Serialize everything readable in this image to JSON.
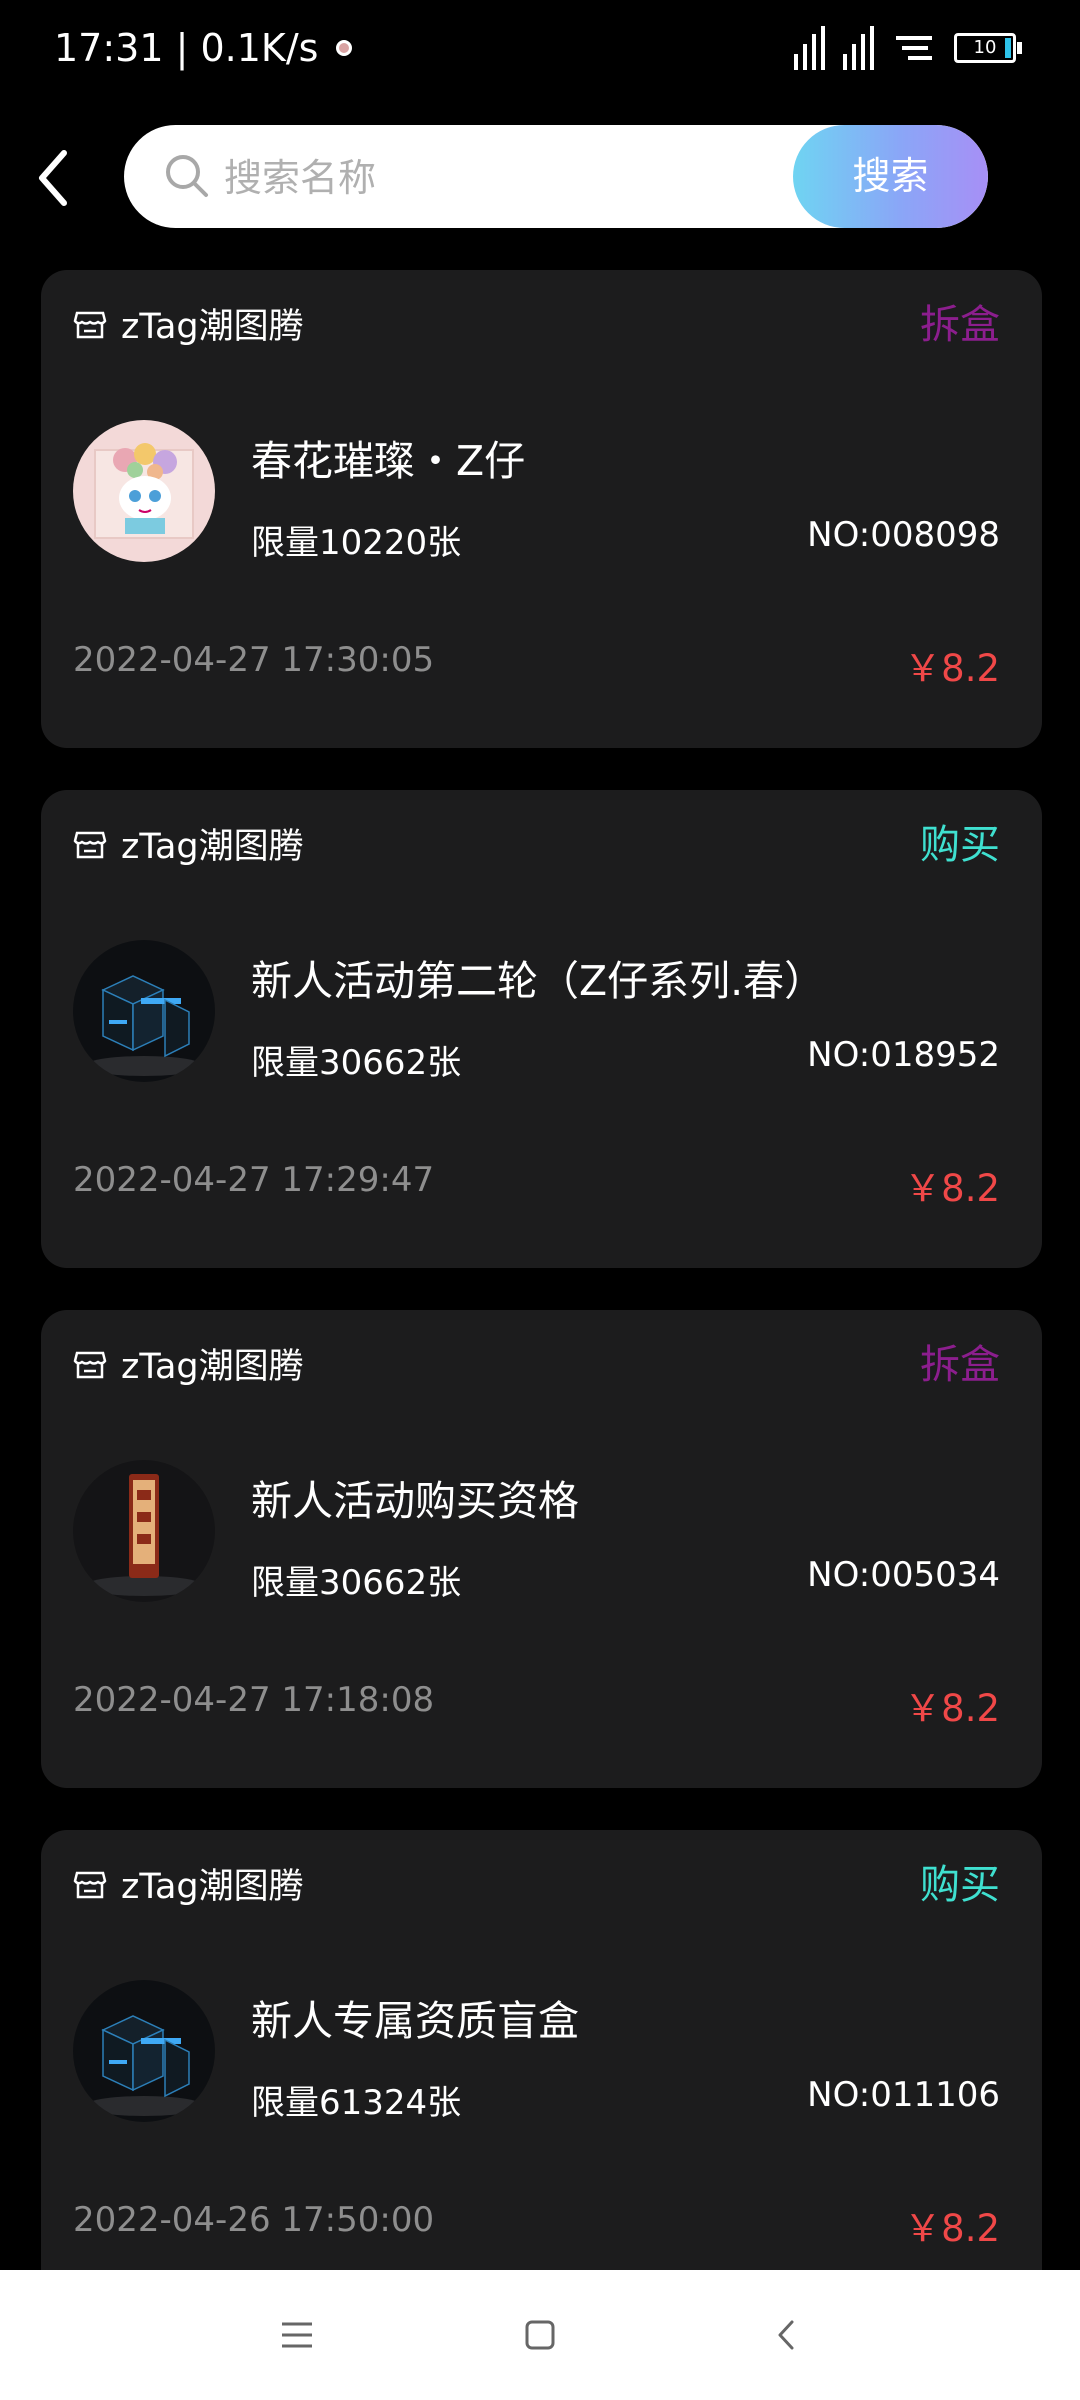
{
  "status_bar": {
    "time_speed": "17:31 | 0.1K/s",
    "battery": "10",
    "battery_color": "#2ec3ea"
  },
  "header": {
    "back_icon": "chevron-left-icon",
    "search": {
      "placeholder": "搜索名称",
      "value": "",
      "button_label": "搜索"
    }
  },
  "colors": {
    "action_unbox": "#8c1e8e",
    "action_buy": "#3fe0d0",
    "price": "#f04848",
    "card_bg": "#1c1c1d"
  },
  "orders": [
    {
      "shop": "zTag潮图腾",
      "action": "拆盒",
      "action_type": "unbox",
      "title": "春花璀璨・Z仔",
      "limit": "限量10220张",
      "no": "NO:008098",
      "time": "2022-04-27 17:30:05",
      "price": "￥8.2",
      "thumb": "flower-character-image"
    },
    {
      "shop": "zTag潮图腾",
      "action": "购买",
      "action_type": "buy",
      "title": "新人活动第二轮（Z仔系列.春）",
      "limit": "限量30662张",
      "no": "NO:018952",
      "time": "2022-04-27 17:29:47",
      "price": "￥8.2",
      "thumb": "blind-box-cubes-image"
    },
    {
      "shop": "zTag潮图腾",
      "action": "拆盒",
      "action_type": "unbox",
      "title": "新人活动购买资格",
      "limit": "限量30662张",
      "no": "NO:005034",
      "time": "2022-04-27 17:18:08",
      "price": "￥8.2",
      "thumb": "fortune-stick-image"
    },
    {
      "shop": "zTag潮图腾",
      "action": "购买",
      "action_type": "buy",
      "title": "新人专属资质盲盒",
      "limit": "限量61324张",
      "no": "NO:011106",
      "time": "2022-04-26 17:50:00",
      "price": "￥8.2",
      "thumb": "blind-box-cubes-image"
    }
  ],
  "nav_bar": {
    "icons": [
      "menu-icon",
      "home-square-icon",
      "back-triangle-icon"
    ]
  }
}
